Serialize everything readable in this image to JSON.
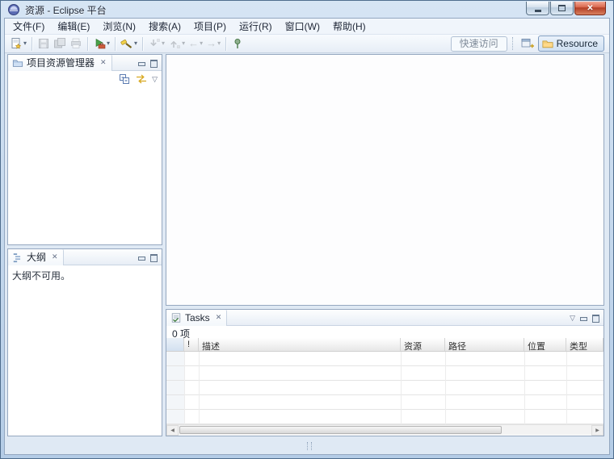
{
  "window": {
    "title": "资源 - Eclipse 平台"
  },
  "menubar": {
    "items": [
      {
        "label": "文件(F)"
      },
      {
        "label": "编辑(E)"
      },
      {
        "label": "浏览(N)"
      },
      {
        "label": "搜索(A)"
      },
      {
        "label": "项目(P)"
      },
      {
        "label": "运行(R)"
      },
      {
        "label": "窗口(W)"
      },
      {
        "label": "帮助(H)"
      }
    ]
  },
  "toolbar": {
    "quick_access_label": "快速访问",
    "perspective_button_label": "Resource"
  },
  "project_explorer": {
    "tab_label": "项目资源管理器"
  },
  "outline": {
    "tab_label": "大纲",
    "empty_message": "大纲不可用。"
  },
  "tasks": {
    "tab_label": "Tasks",
    "items_count_label": "0 项",
    "columns": [
      {
        "label": ""
      },
      {
        "label": "!"
      },
      {
        "label": "描述"
      },
      {
        "label": "资源"
      },
      {
        "label": "路径"
      },
      {
        "label": "位置"
      },
      {
        "label": "类型"
      }
    ],
    "rows": []
  },
  "icons": {
    "close_glyph": "✕",
    "view_menu_glyph": "▽",
    "dropdown_glyph": "▾",
    "back_glyph": "←",
    "forward_glyph": "→",
    "scroll_left_glyph": "◀",
    "scroll_right_glyph": "▶"
  },
  "colors": {
    "titlebar": "#d6e5f4",
    "chrome": "#e6edf6",
    "panel_border": "#96a8c0",
    "close_button": "#d8654b",
    "perspective_button_bg": "#cfe0f2"
  }
}
